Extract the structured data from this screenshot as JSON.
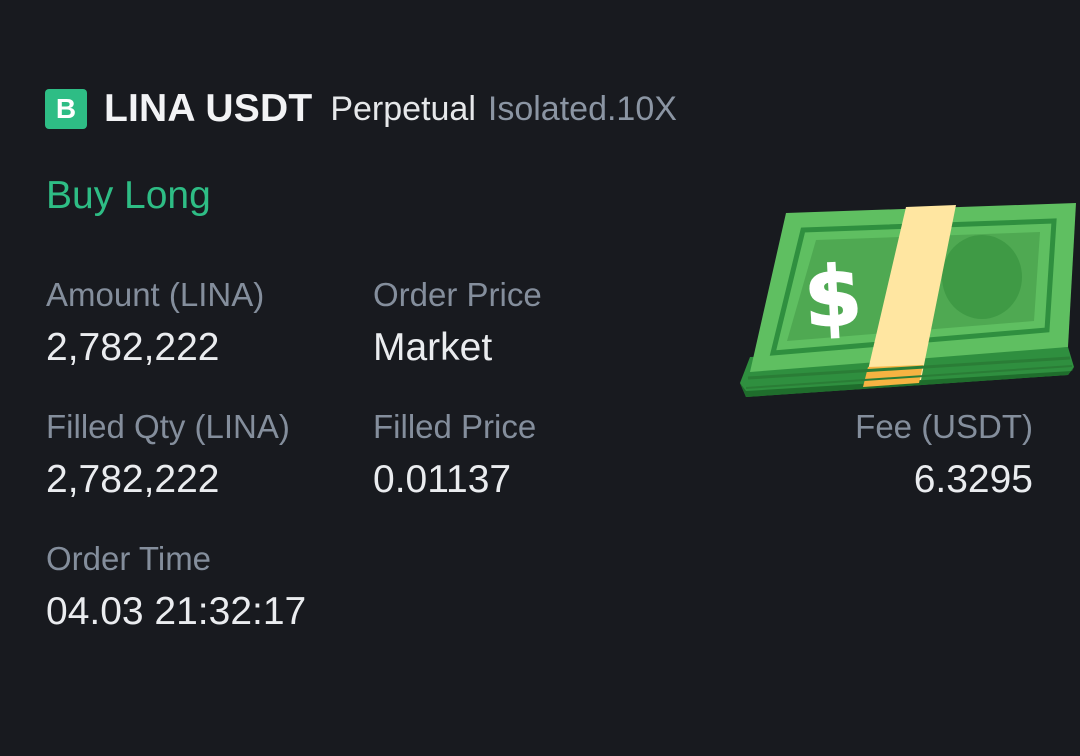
{
  "header": {
    "badge": "B",
    "pair": "LINA USDT",
    "contract_type": "Perpetual",
    "margin_mode": "Isolated.10X"
  },
  "order": {
    "side": "Buy Long",
    "amount_label": "Amount (LINA)",
    "amount_value": "2,782,222",
    "order_price_label": "Order Price",
    "order_price_value": "Market",
    "filled_qty_label": "Filled Qty (LINA)",
    "filled_qty_value": "2,782,222",
    "filled_price_label": "Filled Price",
    "filled_price_value": "0.01137",
    "fee_label": "Fee (USDT)",
    "fee_value": "6.3295",
    "order_time_label": "Order Time",
    "order_time_value": "04.03 21:32:17"
  },
  "icons": {
    "badge": "b-badge-icon",
    "money": "money-stack-icon"
  },
  "colors": {
    "background": "#181a1f",
    "buy": "#2ebd85",
    "label": "#848e9c",
    "value": "#eaecef"
  }
}
